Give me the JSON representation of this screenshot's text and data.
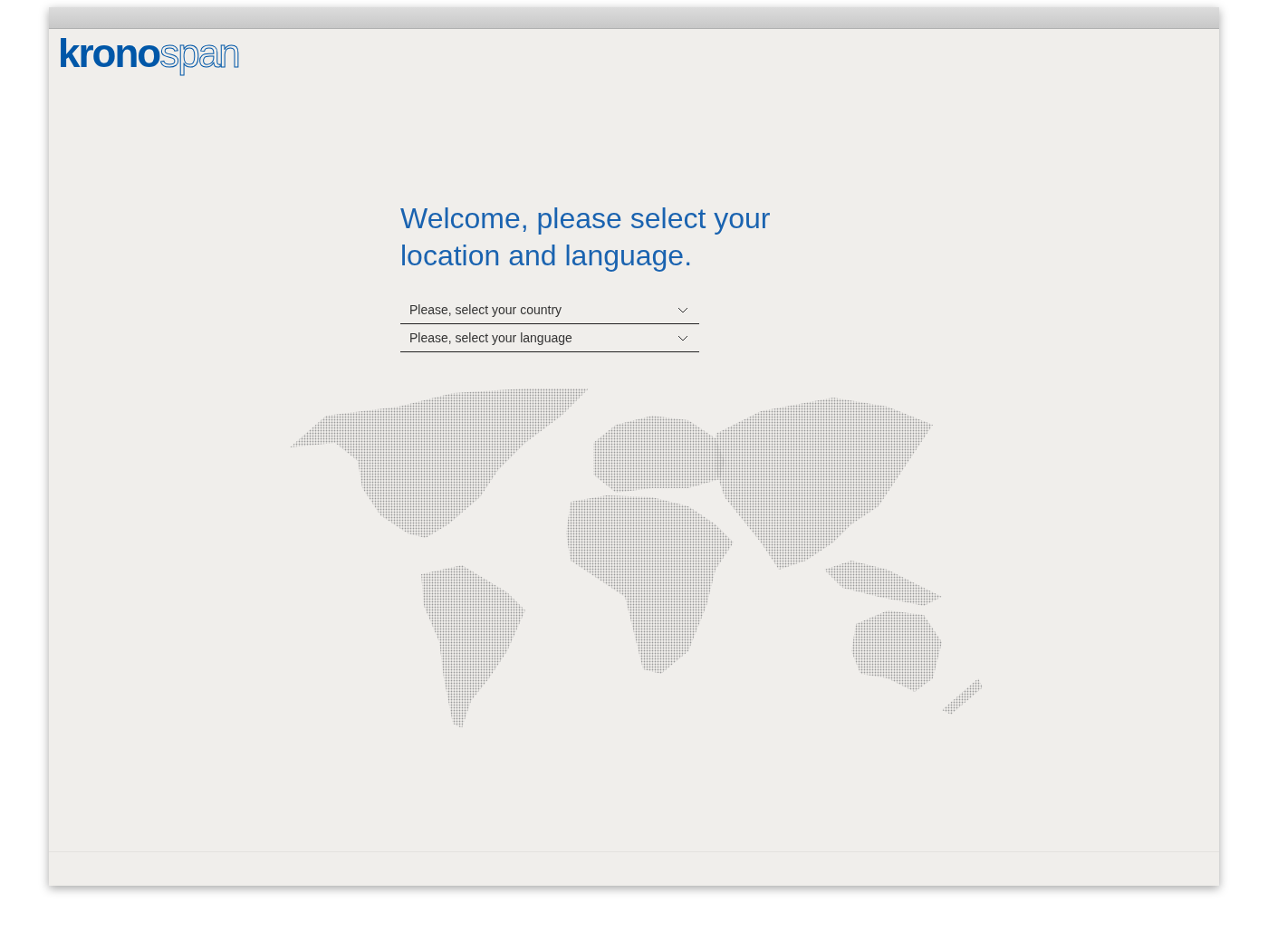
{
  "logo": {
    "bold_part": "krono",
    "outline_part": "span"
  },
  "heading": "Welcome, please select your location and language.",
  "selects": [
    {
      "placeholder": "Please, select your country"
    },
    {
      "placeholder": "Please, select your language"
    }
  ]
}
